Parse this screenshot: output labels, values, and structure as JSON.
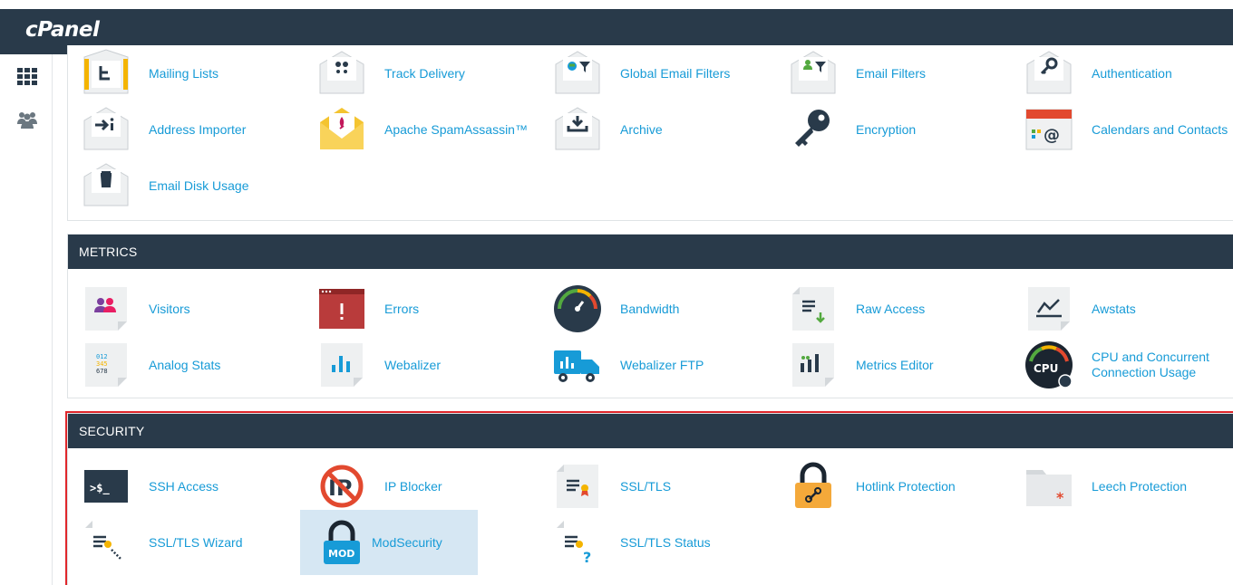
{
  "app": {
    "logo": "cPanel"
  },
  "sidebar": {
    "items": [
      {
        "icon": "grid-icon"
      },
      {
        "icon": "users-icon"
      }
    ]
  },
  "email": {
    "items": [
      {
        "label": "Mailing Lists",
        "icon": "mailing-lists-icon"
      },
      {
        "label": "Track Delivery",
        "icon": "track-delivery-icon"
      },
      {
        "label": "Global Email Filters",
        "icon": "global-email-filters-icon"
      },
      {
        "label": "Email Filters",
        "icon": "email-filters-icon"
      },
      {
        "label": "Authentication",
        "icon": "authentication-icon"
      },
      {
        "label": "Address Importer",
        "icon": "address-importer-icon"
      },
      {
        "label": "Apache SpamAssassin™",
        "icon": "spamassassin-icon"
      },
      {
        "label": "Archive",
        "icon": "archive-icon"
      },
      {
        "label": "Encryption",
        "icon": "encryption-key-icon"
      },
      {
        "label": "Calendars and Contacts",
        "icon": "calendar-icon"
      },
      {
        "label": "Email Disk Usage",
        "icon": "disk-usage-icon"
      }
    ]
  },
  "metrics": {
    "title": "METRICS",
    "items": [
      {
        "label": "Visitors",
        "icon": "visitors-icon"
      },
      {
        "label": "Errors",
        "icon": "errors-icon"
      },
      {
        "label": "Bandwidth",
        "icon": "bandwidth-gauge-icon"
      },
      {
        "label": "Raw Access",
        "icon": "raw-access-icon"
      },
      {
        "label": "Awstats",
        "icon": "awstats-icon"
      },
      {
        "label": "Analog Stats",
        "icon": "analog-stats-icon"
      },
      {
        "label": "Webalizer",
        "icon": "webalizer-icon"
      },
      {
        "label": "Webalizer FTP",
        "icon": "webalizer-ftp-icon"
      },
      {
        "label": "Metrics Editor",
        "icon": "metrics-editor-icon"
      },
      {
        "label": "CPU and Concurrent Connection Usage",
        "label_line1": "CPU and Concurrent",
        "label_line2": "Connection Usage",
        "icon": "cpu-icon"
      }
    ]
  },
  "security": {
    "title": "SECURITY",
    "items": [
      {
        "label": "SSH Access",
        "icon": "terminal-icon"
      },
      {
        "label": "IP Blocker",
        "icon": "ip-blocker-icon"
      },
      {
        "label": "SSL/TLS",
        "icon": "ssl-certificate-icon"
      },
      {
        "label": "Hotlink Protection",
        "icon": "hotlink-lock-icon"
      },
      {
        "label": "Leech Protection",
        "icon": "leech-folder-icon"
      },
      {
        "label": "SSL/TLS Wizard",
        "icon": "ssl-wizard-icon"
      },
      {
        "label": "ModSecurity",
        "icon": "modsecurity-lock-icon",
        "highlighted": true
      },
      {
        "label": "SSL/TLS Status",
        "icon": "ssl-status-icon"
      }
    ],
    "outline_color": "#e0272b"
  },
  "colors": {
    "header": "#293a4a",
    "link": "#179bd7",
    "highlight": "#d6e7f3"
  }
}
